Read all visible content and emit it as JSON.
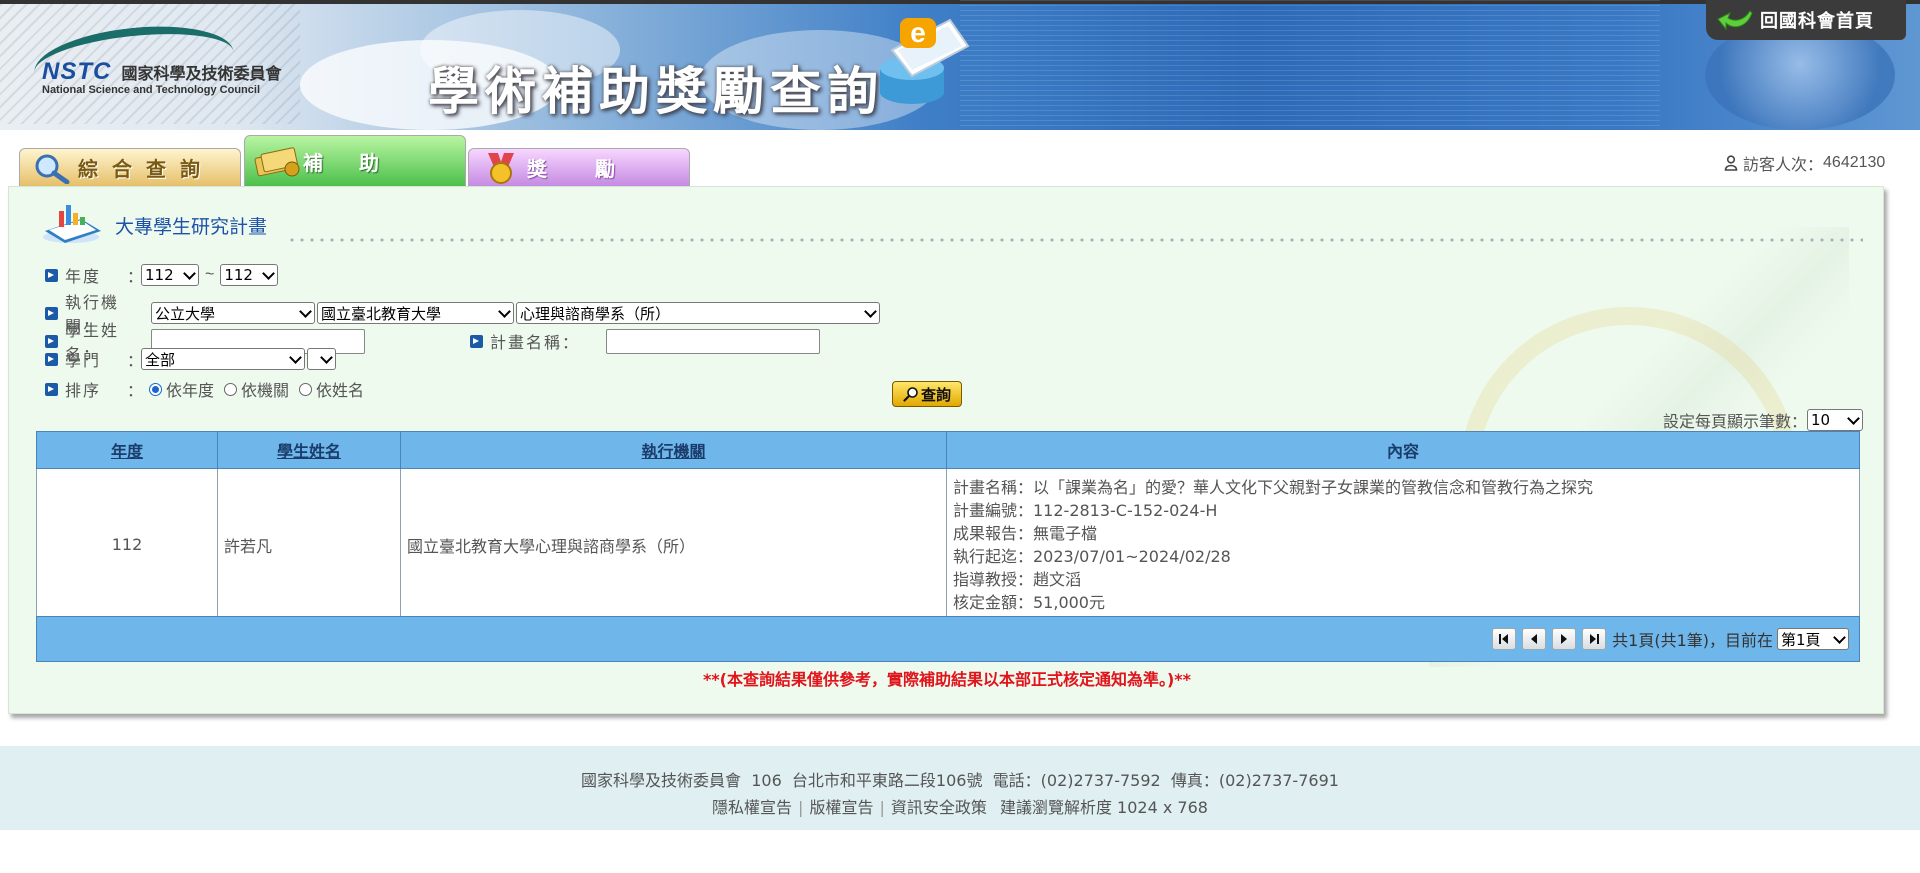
{
  "banner": {
    "org_logo_text": "NSTC",
    "org_name_zh": "國家科學及技術委員會",
    "org_name_en": "National Science and Technology Council",
    "title": "學術補助獎勵查詢",
    "home_button": "回國科會首頁"
  },
  "tabs": [
    {
      "label": "綜合查詢"
    },
    {
      "label": "補助"
    },
    {
      "label": "獎勵"
    }
  ],
  "visitor": {
    "label": "訪客人次：",
    "count": "4642130"
  },
  "section": {
    "title": "大專學生研究計畫"
  },
  "form": {
    "year_label": "年度",
    "colon": "：",
    "year_from": "112",
    "year_sep": "~",
    "year_to": "112",
    "institution_label": "執行機關：",
    "inst_type": "公立大學",
    "inst_school": "國立臺北教育大學",
    "inst_dept": "心理與諮商學系（所）",
    "student_label": "學生姓名：",
    "student_value": "",
    "plan_label": "計畫名稱：",
    "plan_value": "",
    "field_label": "學門",
    "field_value": "全部",
    "field_sub_value": "",
    "sort_label": "排序",
    "sort_options": [
      "依年度",
      "依機關",
      "依姓名"
    ],
    "sort_selected": "依年度",
    "search_button": "查詢",
    "perpage_label": "設定每頁顯示筆數：",
    "perpage_value": "10"
  },
  "table": {
    "headers": [
      "年度",
      "學生姓名",
      "執行機關",
      "內容"
    ],
    "rows": [
      {
        "year": "112",
        "student": "許若凡",
        "institution": "國立臺北教育大學心理與諮商學系（所）",
        "content": [
          "計畫名稱：以「課業為名」的愛？華人文化下父親對子女課業的管教信念和管教行為之探究",
          "計畫編號：112-2813-C-152-024-H",
          "成果報告：無電子檔",
          "執行起迄：2023/07/01~2024/02/28",
          "指導教授：趙文滔",
          "核定金額：51,000元"
        ]
      }
    ]
  },
  "pager": {
    "summary": "共1頁(共1筆)，目前在",
    "current_page": "第1頁"
  },
  "note": "**(本查詢結果僅供參考，實際補助結果以本部正式核定通知為準。)**",
  "footer": {
    "line1": "國家科學及技術委員會  106  台北市和平東路二段106號  電話：(02)2737-7592  傳真：(02)2737-7691",
    "links": [
      "隱私權宣告",
      "版權宣告",
      "資訊安全政策"
    ],
    "resolution": "建議瀏覽解析度 1024 x 768"
  }
}
